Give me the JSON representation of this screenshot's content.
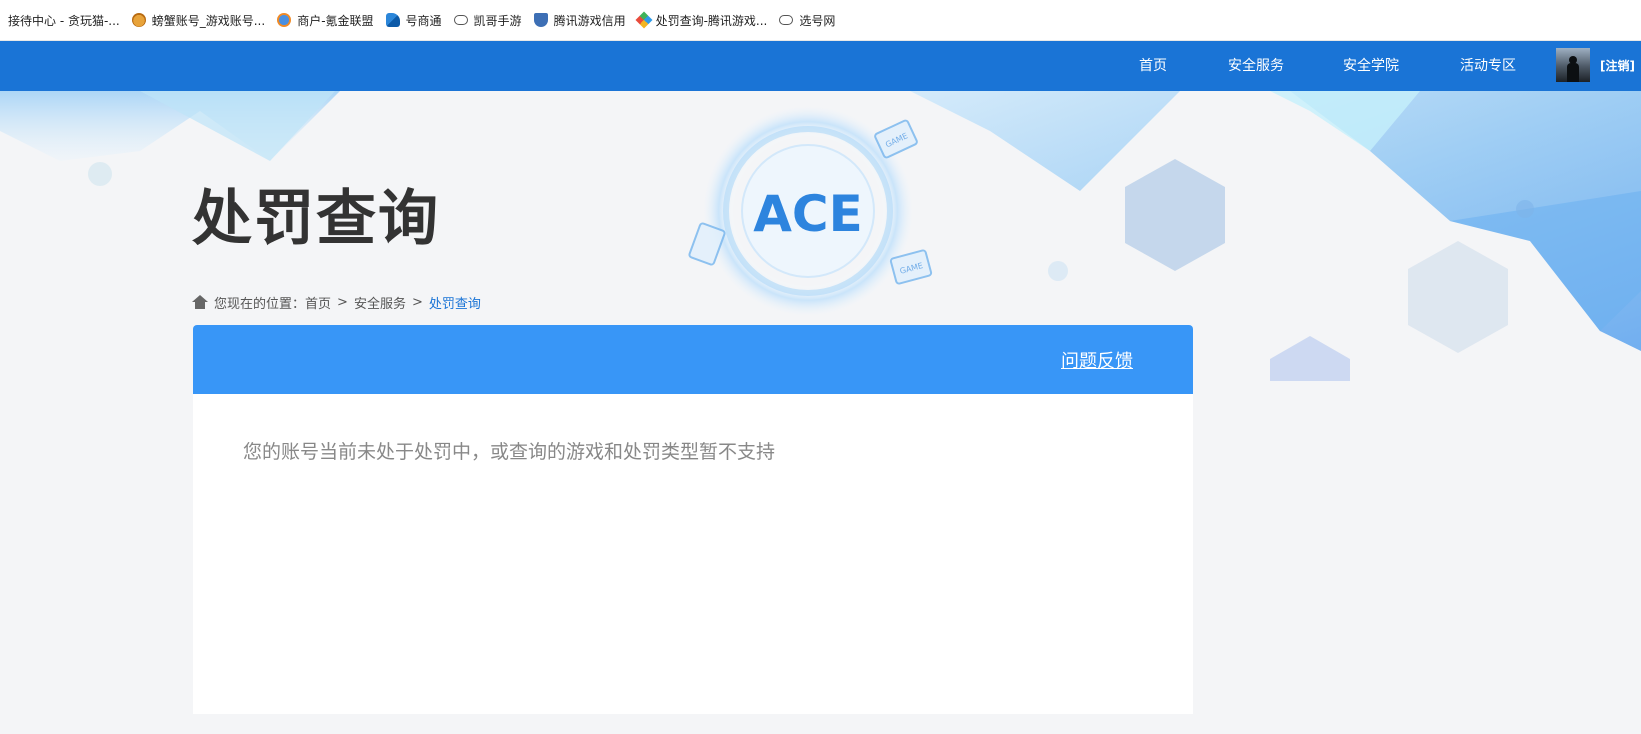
{
  "bookmarks": [
    {
      "label": "接待中心 - 贪玩猫-...",
      "icon": "none"
    },
    {
      "label": "螃蟹账号_游戏账号...",
      "icon": "cat-icon"
    },
    {
      "label": "商户-氪金联盟",
      "icon": "duck-icon"
    },
    {
      "label": "号商通",
      "icon": "boat-icon"
    },
    {
      "label": "凯哥手游",
      "icon": "gamepad-icon"
    },
    {
      "label": "腾讯游戏信用",
      "icon": "shield-icon"
    },
    {
      "label": "处罚查询-腾讯游戏...",
      "icon": "diamond-icon"
    },
    {
      "label": "选号网",
      "icon": "gamepad-icon"
    }
  ],
  "nav": {
    "items": [
      "首页",
      "安全服务",
      "安全学院",
      "活动专区"
    ],
    "logout": "[注销]"
  },
  "page": {
    "title": "处罚查询",
    "breadcrumb": {
      "prefix": "您现在的位置：",
      "home": "首页",
      "section": "安全服务",
      "current": "处罚查询",
      "separator": ">"
    }
  },
  "panel": {
    "feedback_link": "问题反馈",
    "notice": "您的账号当前未处于处罚中，或查询的游戏和处罚类型暂不支持"
  },
  "banner": {
    "logo_text": "ACE",
    "badge_text": "GAME"
  },
  "colors": {
    "nav": "#1a74d6",
    "panel_header": "#3896f7",
    "accent": "#1a74d6"
  }
}
